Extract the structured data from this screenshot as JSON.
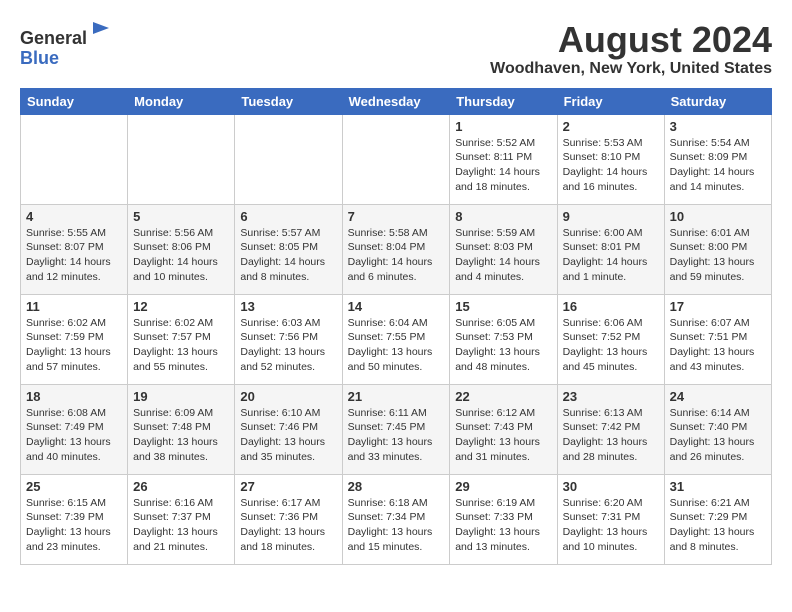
{
  "header": {
    "logo_line1": "General",
    "logo_line2": "Blue",
    "month_year": "August 2024",
    "location": "Woodhaven, New York, United States"
  },
  "weekdays": [
    "Sunday",
    "Monday",
    "Tuesday",
    "Wednesday",
    "Thursday",
    "Friday",
    "Saturday"
  ],
  "weeks": [
    [
      {
        "day": "",
        "info": ""
      },
      {
        "day": "",
        "info": ""
      },
      {
        "day": "",
        "info": ""
      },
      {
        "day": "",
        "info": ""
      },
      {
        "day": "1",
        "info": "Sunrise: 5:52 AM\nSunset: 8:11 PM\nDaylight: 14 hours\nand 18 minutes."
      },
      {
        "day": "2",
        "info": "Sunrise: 5:53 AM\nSunset: 8:10 PM\nDaylight: 14 hours\nand 16 minutes."
      },
      {
        "day": "3",
        "info": "Sunrise: 5:54 AM\nSunset: 8:09 PM\nDaylight: 14 hours\nand 14 minutes."
      }
    ],
    [
      {
        "day": "4",
        "info": "Sunrise: 5:55 AM\nSunset: 8:07 PM\nDaylight: 14 hours\nand 12 minutes."
      },
      {
        "day": "5",
        "info": "Sunrise: 5:56 AM\nSunset: 8:06 PM\nDaylight: 14 hours\nand 10 minutes."
      },
      {
        "day": "6",
        "info": "Sunrise: 5:57 AM\nSunset: 8:05 PM\nDaylight: 14 hours\nand 8 minutes."
      },
      {
        "day": "7",
        "info": "Sunrise: 5:58 AM\nSunset: 8:04 PM\nDaylight: 14 hours\nand 6 minutes."
      },
      {
        "day": "8",
        "info": "Sunrise: 5:59 AM\nSunset: 8:03 PM\nDaylight: 14 hours\nand 4 minutes."
      },
      {
        "day": "9",
        "info": "Sunrise: 6:00 AM\nSunset: 8:01 PM\nDaylight: 14 hours\nand 1 minute."
      },
      {
        "day": "10",
        "info": "Sunrise: 6:01 AM\nSunset: 8:00 PM\nDaylight: 13 hours\nand 59 minutes."
      }
    ],
    [
      {
        "day": "11",
        "info": "Sunrise: 6:02 AM\nSunset: 7:59 PM\nDaylight: 13 hours\nand 57 minutes."
      },
      {
        "day": "12",
        "info": "Sunrise: 6:02 AM\nSunset: 7:57 PM\nDaylight: 13 hours\nand 55 minutes."
      },
      {
        "day": "13",
        "info": "Sunrise: 6:03 AM\nSunset: 7:56 PM\nDaylight: 13 hours\nand 52 minutes."
      },
      {
        "day": "14",
        "info": "Sunrise: 6:04 AM\nSunset: 7:55 PM\nDaylight: 13 hours\nand 50 minutes."
      },
      {
        "day": "15",
        "info": "Sunrise: 6:05 AM\nSunset: 7:53 PM\nDaylight: 13 hours\nand 48 minutes."
      },
      {
        "day": "16",
        "info": "Sunrise: 6:06 AM\nSunset: 7:52 PM\nDaylight: 13 hours\nand 45 minutes."
      },
      {
        "day": "17",
        "info": "Sunrise: 6:07 AM\nSunset: 7:51 PM\nDaylight: 13 hours\nand 43 minutes."
      }
    ],
    [
      {
        "day": "18",
        "info": "Sunrise: 6:08 AM\nSunset: 7:49 PM\nDaylight: 13 hours\nand 40 minutes."
      },
      {
        "day": "19",
        "info": "Sunrise: 6:09 AM\nSunset: 7:48 PM\nDaylight: 13 hours\nand 38 minutes."
      },
      {
        "day": "20",
        "info": "Sunrise: 6:10 AM\nSunset: 7:46 PM\nDaylight: 13 hours\nand 35 minutes."
      },
      {
        "day": "21",
        "info": "Sunrise: 6:11 AM\nSunset: 7:45 PM\nDaylight: 13 hours\nand 33 minutes."
      },
      {
        "day": "22",
        "info": "Sunrise: 6:12 AM\nSunset: 7:43 PM\nDaylight: 13 hours\nand 31 minutes."
      },
      {
        "day": "23",
        "info": "Sunrise: 6:13 AM\nSunset: 7:42 PM\nDaylight: 13 hours\nand 28 minutes."
      },
      {
        "day": "24",
        "info": "Sunrise: 6:14 AM\nSunset: 7:40 PM\nDaylight: 13 hours\nand 26 minutes."
      }
    ],
    [
      {
        "day": "25",
        "info": "Sunrise: 6:15 AM\nSunset: 7:39 PM\nDaylight: 13 hours\nand 23 minutes."
      },
      {
        "day": "26",
        "info": "Sunrise: 6:16 AM\nSunset: 7:37 PM\nDaylight: 13 hours\nand 21 minutes."
      },
      {
        "day": "27",
        "info": "Sunrise: 6:17 AM\nSunset: 7:36 PM\nDaylight: 13 hours\nand 18 minutes."
      },
      {
        "day": "28",
        "info": "Sunrise: 6:18 AM\nSunset: 7:34 PM\nDaylight: 13 hours\nand 15 minutes."
      },
      {
        "day": "29",
        "info": "Sunrise: 6:19 AM\nSunset: 7:33 PM\nDaylight: 13 hours\nand 13 minutes."
      },
      {
        "day": "30",
        "info": "Sunrise: 6:20 AM\nSunset: 7:31 PM\nDaylight: 13 hours\nand 10 minutes."
      },
      {
        "day": "31",
        "info": "Sunrise: 6:21 AM\nSunset: 7:29 PM\nDaylight: 13 hours\nand 8 minutes."
      }
    ]
  ]
}
